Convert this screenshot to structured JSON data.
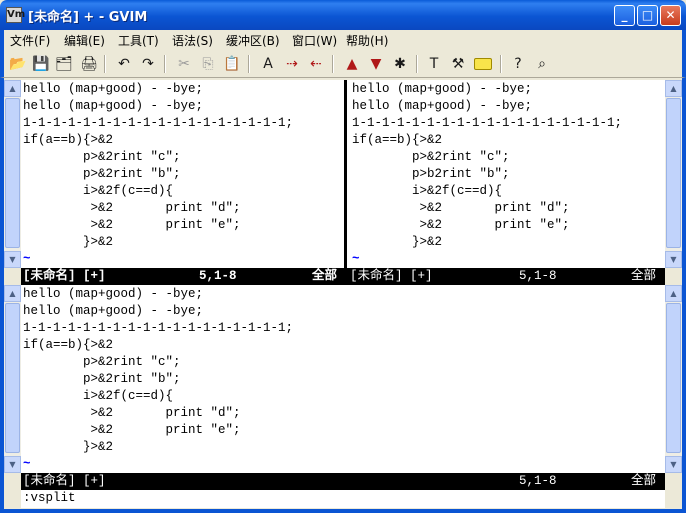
{
  "window": {
    "title": "[未命名] + - GVIM",
    "app_icon_label": "Vm",
    "buttons": {
      "minimize": "_",
      "maximize": "□",
      "close": "✕"
    }
  },
  "menu": [
    {
      "label": "文件(F)"
    },
    {
      "label": "编辑(E)"
    },
    {
      "label": "工具(T)"
    },
    {
      "label": "语法(S)"
    },
    {
      "label": "缓冲区(B)"
    },
    {
      "label": "窗口(W)"
    },
    {
      "label": "帮助(H)"
    }
  ],
  "toolbar": [
    {
      "name": "open-icon",
      "glyph": "📂"
    },
    {
      "name": "save-icon",
      "glyph": "💾"
    },
    {
      "name": "save-all-icon",
      "glyph": "🗂"
    },
    {
      "name": "print-icon",
      "glyph": "🖨"
    },
    {
      "name": "undo-icon",
      "glyph": "↶"
    },
    {
      "name": "redo-icon",
      "glyph": "↷"
    },
    {
      "name": "cut-icon",
      "glyph": "✂"
    },
    {
      "name": "copy-icon",
      "glyph": "⎘"
    },
    {
      "name": "paste-icon",
      "glyph": "📋"
    },
    {
      "name": "replace-icon",
      "glyph": "A"
    },
    {
      "name": "find-next-icon",
      "glyph": "⇢"
    },
    {
      "name": "find-prev-icon",
      "glyph": "⇠"
    },
    {
      "name": "load-session-icon",
      "glyph": "▲"
    },
    {
      "name": "save-session-icon",
      "glyph": "▼"
    },
    {
      "name": "run-script-icon",
      "glyph": "✱"
    },
    {
      "name": "make-icon",
      "glyph": "T"
    },
    {
      "name": "shell-icon",
      "glyph": "⚒"
    },
    {
      "name": "tag-icon",
      "glyph": ""
    },
    {
      "name": "help-icon",
      "glyph": "?"
    },
    {
      "name": "find-help-icon",
      "glyph": "⌕"
    }
  ],
  "buffer": {
    "lines": [
      "hello (map+good) - -bye;",
      "hello (map+good) - -bye;",
      "1-1-1-1-1-1-1-1-1-1-1-1-1-1-1-1-1-1;",
      "if(a==b){>&2",
      "        p>&2rint \"c\";",
      "        p>&2rint \"b\";",
      "        i>&2f(c==d){",
      "         >&2       print \"d\";",
      "         >&2       print \"e\";",
      "        }>&2"
    ],
    "right_lines": [
      "hello (map+good) - -bye;",
      "hello (map+good) - -bye;",
      "1-1-1-1-1-1-1-1-1-1-1-1-1-1-1-1-1-1;",
      "if(a==b){>&2",
      "        p>&2rint \"c\";",
      "        p>b2rint \"b\";",
      "        i>&2f(c==d){",
      "         >&2       print \"d\";",
      "         >&2       print \"e\";",
      "        }>&2"
    ],
    "tilde": "~"
  },
  "status": {
    "top_left": {
      "name": "[未命名] [+]",
      "pos": "5,1-8",
      "scroll": "全部"
    },
    "top_right": {
      "name": "[未命名] [+]",
      "pos": "5,1-8",
      "scroll": "全部"
    },
    "bottom": {
      "name": "[未命名] [+]",
      "pos": "5,1-8",
      "scroll": "全部"
    }
  },
  "cmdline": ":vsplit"
}
